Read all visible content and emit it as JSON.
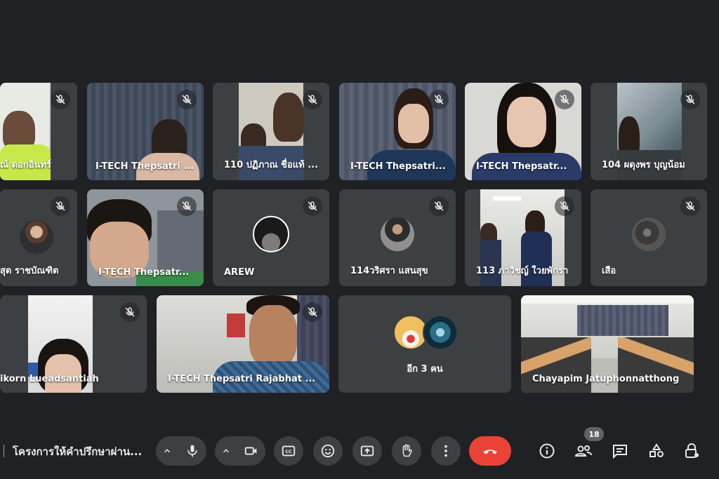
{
  "tiles": [
    {
      "name": "ณ์ ดอกอินทร์"
    },
    {
      "name": "I-TECH Thepsatri ..."
    },
    {
      "name": "110 ปฏิภาณ ชื่อแท้ ..."
    },
    {
      "name": "I-TECH Thepsatri..."
    },
    {
      "name": "I-TECH Thepsatr..."
    },
    {
      "name": "104 ผดุงพร บุญน้อม"
    },
    {
      "name": "สุต ราชบัณฑิต"
    },
    {
      "name": "I-TECH Thepsatr..."
    },
    {
      "name": "AREW"
    },
    {
      "name": "114วริศรา แสนสุข"
    },
    {
      "name": "113 ภาวิชญ์ ใวยพักรา"
    },
    {
      "name": "เสือ"
    },
    {
      "name": "ikorn Lueadsantiah"
    },
    {
      "name": "I-TECH Thepsatri Rajabhat ..."
    },
    {
      "name": "อีก 3 คน"
    },
    {
      "name": "Chayapim Jatuphonnatthong"
    }
  ],
  "meeting": {
    "title": "โครงการให้คำปรึกษาผ่าน..."
  },
  "controls": {
    "participant_count": "18"
  },
  "colors": {
    "background": "#202124",
    "tile": "#3c4043",
    "end_call": "#ea4335"
  }
}
